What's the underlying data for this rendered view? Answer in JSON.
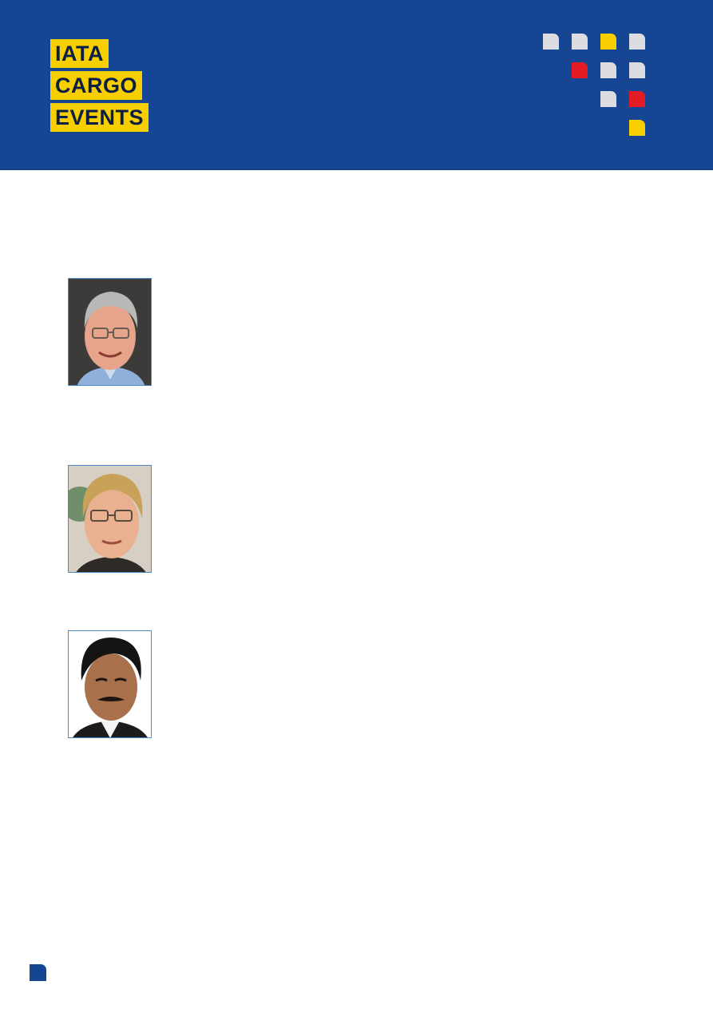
{
  "header": {
    "logo_lines": [
      "IATA",
      "CARGO",
      "EVENTS"
    ],
    "colors": {
      "band": "#164594",
      "logo_bg": "#f7cf00",
      "accent_red": "#e31b23",
      "tile_grey": "#dcdde1"
    }
  },
  "speakers": [
    {
      "photo": "portrait-grey-haired-man-glasses"
    },
    {
      "photo": "portrait-blond-man-glasses"
    },
    {
      "photo": "portrait-dark-haired-man-mustache"
    }
  ]
}
